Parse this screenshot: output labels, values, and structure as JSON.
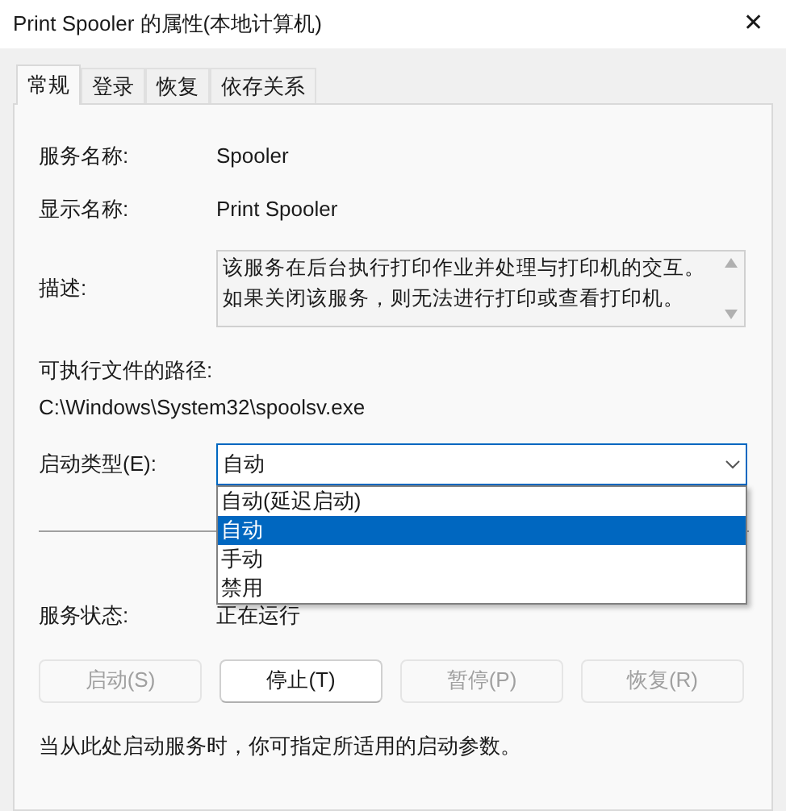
{
  "window": {
    "title": "Print Spooler 的属性(本地计算机)",
    "close": "✕"
  },
  "tabs": [
    {
      "label": "常规",
      "selected": true
    },
    {
      "label": "登录",
      "selected": false
    },
    {
      "label": "恢复",
      "selected": false
    },
    {
      "label": "依存关系",
      "selected": false
    }
  ],
  "fields": [
    {
      "label": "服务名称:",
      "value": "Spooler"
    },
    {
      "label": "显示名称:",
      "value": "Print Spooler"
    }
  ],
  "description": {
    "label": "描述:",
    "value": "该服务在后台执行打印作业并处理与打印机的交互。如果关闭该服务，则无法进行打印或查看打印机。"
  },
  "path": {
    "label": "可执行文件的路径:",
    "value": "C:\\Windows\\System32\\spoolsv.exe"
  },
  "startup_type": {
    "label": "启动类型(E):",
    "value": "自动",
    "expanded": true,
    "options": [
      {
        "label": "自动(延迟启动)",
        "selected": false
      },
      {
        "label": "自动",
        "selected": true
      },
      {
        "label": "手动",
        "selected": false
      },
      {
        "label": "禁用",
        "selected": false
      }
    ]
  },
  "service_status": {
    "label": "服务状态:",
    "value": "正在运行"
  },
  "buttons": [
    {
      "label": "启动(S)",
      "disabled": true
    },
    {
      "label": "停止(T)",
      "disabled": false
    },
    {
      "label": "暂停(P)",
      "disabled": true
    },
    {
      "label": "恢复(R)",
      "disabled": true
    }
  ],
  "hint": "当从此处启动服务时，你可指定所适用的启动参数。"
}
